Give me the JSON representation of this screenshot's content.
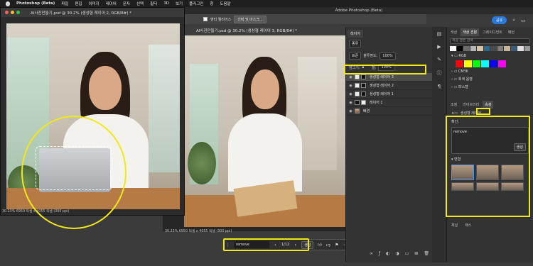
{
  "menubar": {
    "app": "Photoshop (Beta)",
    "items": [
      "파일",
      "편집",
      "이미지",
      "레이어",
      "문자",
      "선택",
      "필터",
      "3D",
      "보기",
      "플러그인",
      "창",
      "도움말"
    ]
  },
  "window_title": "Adobe Photoshop (Beta)",
  "options_bar": {
    "checkbox_label": "앤티 앨리어스",
    "select_mask": "선택 및 마스크..."
  },
  "share_button": "공유",
  "float_doc": {
    "title": "AI사진만들기.psd @ 30.2% (생성형 레이어 2, RGB/8#) *",
    "status": "30.23%    6950 픽셀 x 4055 픽셀 (300 ppi)"
  },
  "main_doc": {
    "title": "AI사진만들기.psd @ 30.2% (생성형 레이어 3, RGB/8#) *",
    "status": "30.23%    6950 픽셀 x 4055 픽셀 (300 ppi)"
  },
  "context_bar": {
    "prompt": "remove",
    "counter": "1/12",
    "generate": "생성",
    "prev": "‹",
    "next": "›"
  },
  "layers_panel": {
    "tab": "레이어",
    "kind": "종류",
    "blend": "표준",
    "opacity_label": "불투명도:",
    "opacity_value": "100%",
    "lock_label": "잠그기:",
    "fill_label": "칠:",
    "fill_value": "100%",
    "layers": [
      {
        "name": "생성형 레이어 3",
        "selected": true
      },
      {
        "name": "생성형 레이어 2",
        "selected": false
      },
      {
        "name": "생성형 레이어 1",
        "selected": false
      },
      {
        "name": "레이어 1",
        "selected": false
      },
      {
        "name": "배경",
        "selected": false
      }
    ]
  },
  "swatches_panel": {
    "tabs": [
      "색상",
      "색상 견본",
      "그레이디언트",
      "패턴"
    ],
    "search": "색상 견본 검색",
    "groups": [
      "RGB",
      "CMYK",
      "회색 음영",
      "파스텔"
    ],
    "top_colors": [
      "#ffffff",
      "#000000",
      "#6b6b6b",
      "#b5b5b5",
      "#d7c2a6",
      "#2a6b8f",
      "#4a4a4a",
      "#7d7d7d",
      "#c9b49a",
      "#3a5c7a",
      "#e0e0e0",
      "#999999"
    ],
    "rgb_colors": [
      "#ff0000",
      "#ffff00",
      "#00ff00",
      "#00ffff",
      "#0000ff",
      "#ff00ff"
    ]
  },
  "properties_panel": {
    "tabs": [
      "조정",
      "라이브러리",
      "속성"
    ],
    "active_tab": "속성",
    "header": "생성형 레이어",
    "prompt_label": "확인:",
    "prompt_value": "remove",
    "generate": "생성",
    "variations_label": "변형"
  },
  "bottom_tabs": [
    "채널",
    "패스"
  ]
}
